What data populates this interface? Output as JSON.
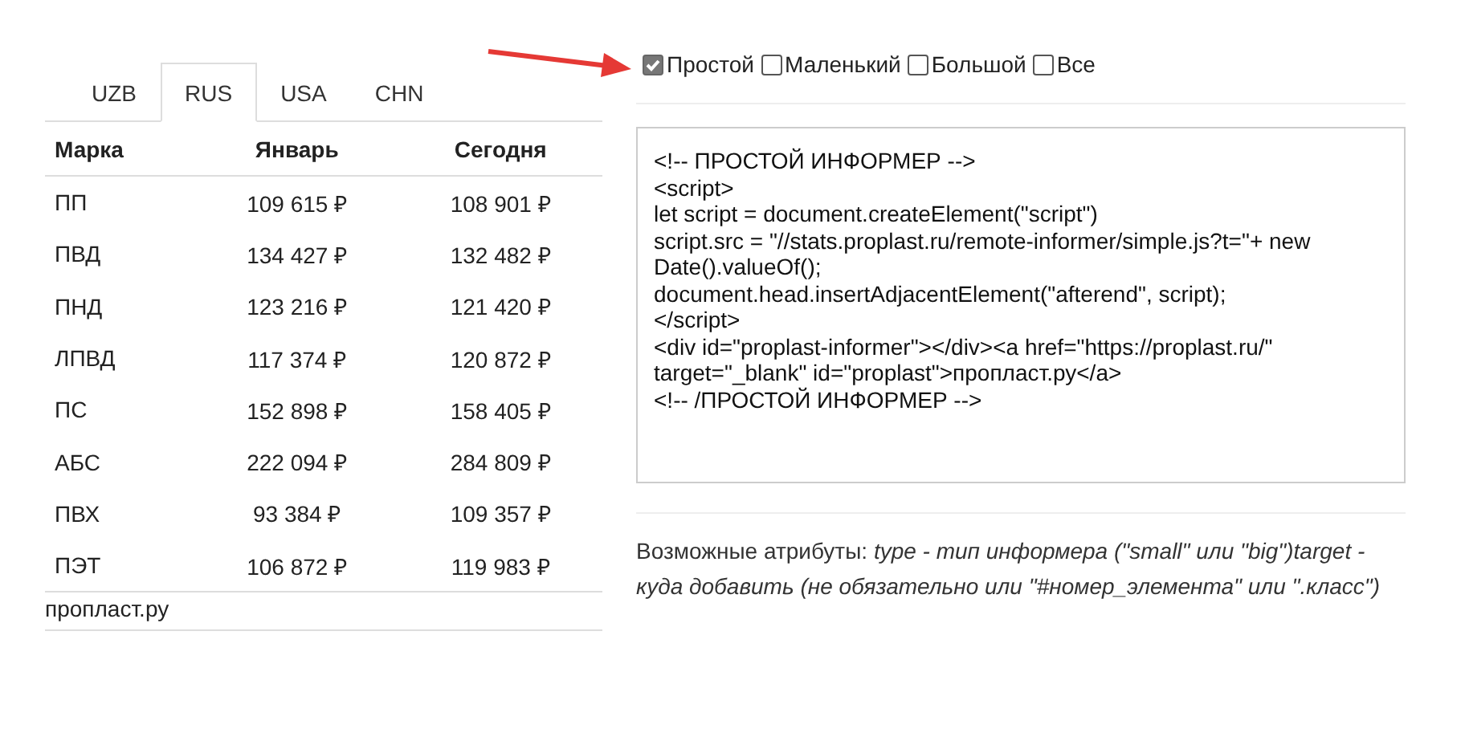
{
  "tabs": [
    {
      "label": "UZB",
      "selected": false
    },
    {
      "label": "RUS",
      "selected": true
    },
    {
      "label": "USA",
      "selected": false
    },
    {
      "label": "CHN",
      "selected": false
    }
  ],
  "table": {
    "columns": [
      "Марка",
      "Январь",
      "Сегодня"
    ],
    "rows": [
      [
        "ПП",
        "109 615 ₽",
        "108 901 ₽"
      ],
      [
        "ПВД",
        "134 427 ₽",
        "132 482 ₽"
      ],
      [
        "ПНД",
        "123 216 ₽",
        "121 420 ₽"
      ],
      [
        "ЛПВД",
        "117 374 ₽",
        "120 872 ₽"
      ],
      [
        "ПС",
        "152 898 ₽",
        "158 405 ₽"
      ],
      [
        "АБС",
        "222 094 ₽",
        "284 809 ₽"
      ],
      [
        "ПВХ",
        "93 384 ₽",
        "109 357 ₽"
      ],
      [
        "ПЭТ",
        "106 872 ₽",
        "119 983 ₽"
      ]
    ],
    "footer": "пропласт.ру"
  },
  "options": [
    {
      "label": "Простой",
      "checked": true
    },
    {
      "label": "Маленький",
      "checked": false
    },
    {
      "label": "Большой",
      "checked": false
    },
    {
      "label": "Все",
      "checked": false
    }
  ],
  "code": "<!-- ПРОСТОЙ ИНФОРМЕР -->\n<script>\nlet script = document.createElement(\"script\")\nscript.src = \"//stats.proplast.ru/remote-informer/simple.js?t=\"+ new Date().valueOf();\ndocument.head.insertAdjacentElement(\"afterend\", script);\n</script>\n<div id=\"proplast-informer\"></div><a href=\"https://proplast.ru/\" target=\"_blank\" id=\"proplast\">пропласт.ру</a>\n<!-- /ПРОСТОЙ ИНФОРМЕР -->",
  "note": "Возможные атрибуты: *type - тип информера (\"small\" или \"big\")target - куда добавить (не обязательно или \"#номер_элемента\" или \".класс\")*"
}
